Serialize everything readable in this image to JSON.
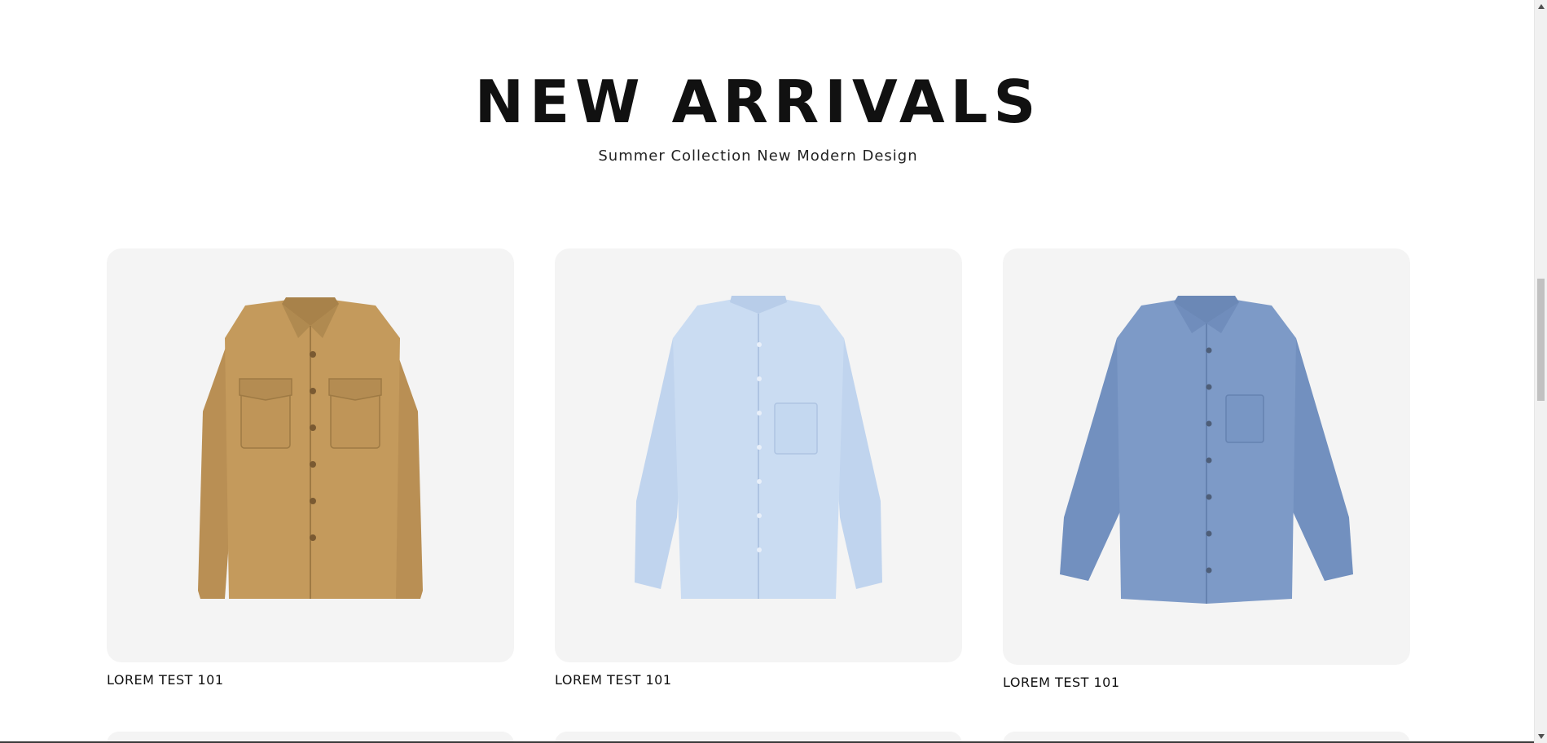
{
  "section": {
    "title": "NEW ARRIVALS",
    "subtitle": "Summer Collection New Modern Design"
  },
  "products": [
    {
      "name": "LOREM TEST 101",
      "image": "tan-utility-shirt",
      "color": "#c49a5c"
    },
    {
      "name": "LOREM TEST 101",
      "image": "light-blue-oxford-shirt",
      "color": "#c9dbf1"
    },
    {
      "name": "LOREM TEST 101",
      "image": "denim-chambray-shirt",
      "color": "#7d9ac7"
    }
  ],
  "colors": {
    "card_background": "#f4f4f4",
    "text": "#111111"
  },
  "scrollbar": {
    "up_icon": "triangle-up-icon",
    "down_icon": "triangle-down-icon"
  }
}
